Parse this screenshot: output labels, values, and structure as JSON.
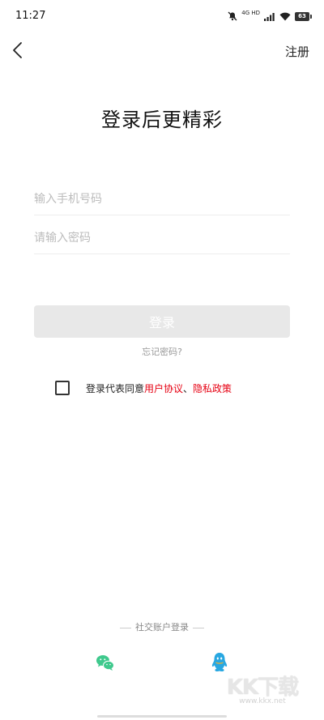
{
  "status_bar": {
    "time": "11:27",
    "network_label": "4G HD",
    "battery_level": "63"
  },
  "nav": {
    "register_label": "注册"
  },
  "title": "登录后更精彩",
  "form": {
    "phone_placeholder": "输入手机号码",
    "phone_value": "",
    "password_placeholder": "请输入密码",
    "password_value": "",
    "login_label": "登录",
    "forgot_label": "忘记密码?"
  },
  "agreement": {
    "checked": false,
    "prefix": "登录代表同意",
    "user_agreement": "用户协议",
    "separator": "、",
    "privacy_policy": "隐私政策"
  },
  "social": {
    "title": "社交账户登录",
    "options": [
      "wechat-icon",
      "qq-icon"
    ]
  },
  "watermark": {
    "logo": "KK下载",
    "url": "www.kkx.net"
  },
  "colors": {
    "accent_red": "#e60012",
    "button_disabled": "#e8e8e8",
    "wechat_green": "#3fc98d",
    "qq_blue": "#28a7e1"
  }
}
